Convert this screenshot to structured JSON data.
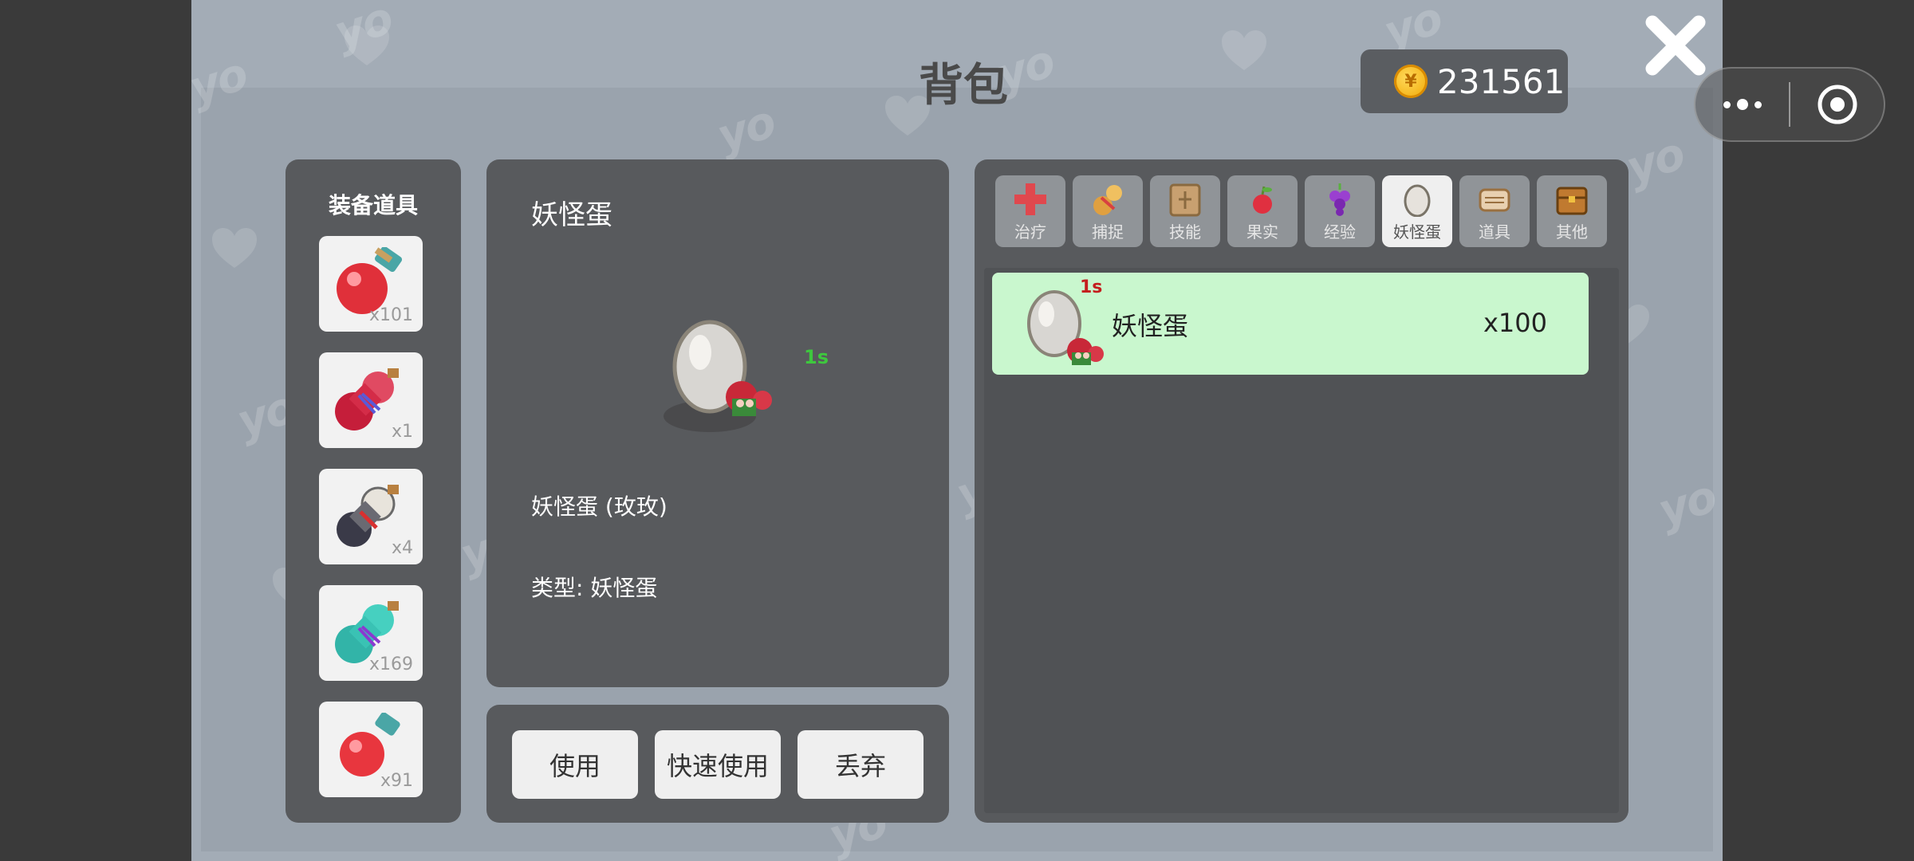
{
  "header": {
    "title": "背包",
    "coins": "231561",
    "coin_symbol": "¥"
  },
  "watermark_text": "yo",
  "equip": {
    "title": "装备道具",
    "slots": [
      {
        "count": "x101",
        "icon": "red-potion-icon"
      },
      {
        "count": "x1",
        "icon": "red-gourd-icon"
      },
      {
        "count": "x4",
        "icon": "dark-gourd-icon"
      },
      {
        "count": "x169",
        "icon": "teal-gourd-icon"
      },
      {
        "count": "x91",
        "icon": "red-potion-small-icon"
      }
    ]
  },
  "detail": {
    "name": "妖怪蛋",
    "timer": "1s",
    "description": "妖怪蛋 (玫玫)",
    "type_line": "类型: 妖怪蛋"
  },
  "actions": {
    "use": "使用",
    "quick_use": "快速使用",
    "discard": "丢弃"
  },
  "tabs": [
    {
      "label": "治疗",
      "icon": "heal-cross-icon",
      "active": false
    },
    {
      "label": "捕捉",
      "icon": "gourd-icon",
      "active": false
    },
    {
      "label": "技能",
      "icon": "skill-book-icon",
      "active": false
    },
    {
      "label": "果实",
      "icon": "fruit-icon",
      "active": false
    },
    {
      "label": "经验",
      "icon": "grape-icon",
      "active": false
    },
    {
      "label": "妖怪蛋",
      "icon": "egg-icon",
      "active": true
    },
    {
      "label": "道具",
      "icon": "scroll-icon",
      "active": false
    },
    {
      "label": "其他",
      "icon": "chest-icon",
      "active": false
    }
  ],
  "items": [
    {
      "name": "妖怪蛋",
      "count": "x100",
      "timer": "1s"
    }
  ],
  "colors": {
    "selected_row": "#c9f7ce",
    "timer_green": "#3ec83e",
    "timer_red": "#c41e1e"
  }
}
